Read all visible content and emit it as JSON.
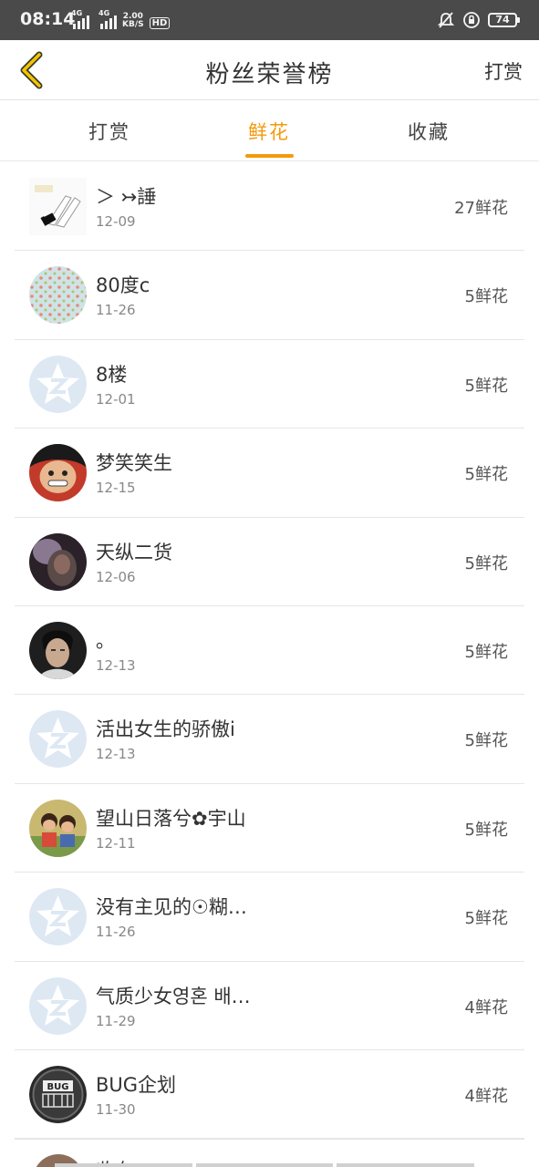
{
  "status_bar": {
    "time": "08:14",
    "net_label_1": "4G",
    "net_label_2": "4G",
    "speed_value": "2.00",
    "speed_unit": "KB/S",
    "wifi_label": "HD",
    "battery": "74",
    "icons": [
      "mute-icon",
      "lock-rotation-icon",
      "battery-icon"
    ]
  },
  "nav": {
    "title": "粉丝荣誉榜",
    "action": "打赏",
    "back_icon": "chevron-left-icon"
  },
  "tabs": [
    {
      "label": "打赏",
      "active": false
    },
    {
      "label": "鲜花",
      "active": true
    },
    {
      "label": "收藏",
      "active": false
    }
  ],
  "accent_color": "#f29a0e",
  "rows": [
    {
      "name": "＞ ↣諈",
      "date": "12-09",
      "count": "27鲜花",
      "avatar": "hands-photo"
    },
    {
      "name": "80度c",
      "date": "11-26",
      "count": "5鲜花",
      "avatar": "pattern"
    },
    {
      "name": "8楼",
      "date": "12-01",
      "count": "5鲜花",
      "avatar": "default-qzone"
    },
    {
      "name": "梦笑笑生",
      "date": "12-15",
      "count": "5鲜花",
      "avatar": "anime-face"
    },
    {
      "name": "天纵二货",
      "date": "12-06",
      "count": "5鲜花",
      "avatar": "dark-photo"
    },
    {
      "name": "。",
      "date": "12-13",
      "count": "5鲜花",
      "avatar": "portrait-photo"
    },
    {
      "name": "活出女生的骄傲i",
      "date": "12-13",
      "count": "5鲜花",
      "avatar": "default-qzone"
    },
    {
      "name": "望山日落兮✿宇山",
      "date": "12-11",
      "count": "5鲜花",
      "avatar": "kids-photo"
    },
    {
      "name": "没有主见的☉糊…",
      "date": "11-26",
      "count": "5鲜花",
      "avatar": "default-qzone"
    },
    {
      "name": "气质少女영혼 배…",
      "date": "11-29",
      "count": "4鲜花",
      "avatar": "default-qzone"
    },
    {
      "name": "BUG企划",
      "date": "11-30",
      "count": "4鲜花",
      "avatar": "bug-logo"
    }
  ],
  "partial_row": {
    "name": "收有"
  }
}
